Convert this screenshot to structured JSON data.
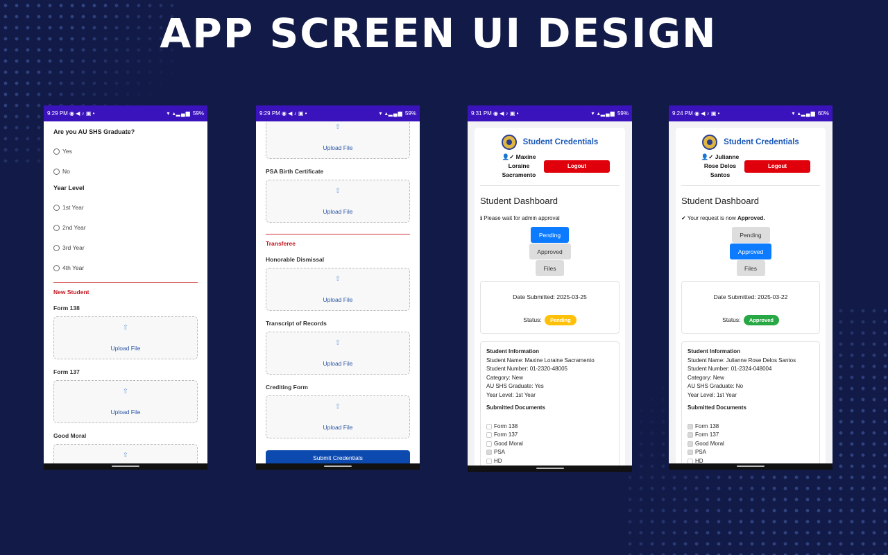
{
  "headline": "APP SCREEN UI DESIGN",
  "screen1": {
    "statusbar": {
      "time": "9:29",
      "ampm": "PM",
      "battery": "59%"
    },
    "graduate_question": "Are you AU SHS Graduate?",
    "graduate_options": [
      "Yes",
      "No"
    ],
    "year_level_label": "Year Level",
    "year_options": [
      "1st Year",
      "2nd Year",
      "3rd Year",
      "4th Year"
    ],
    "section": "New Student",
    "fields": [
      "Form 138",
      "Form 137",
      "Good Moral"
    ],
    "upload_label": "Upload File",
    "upload_icon": "upload-arrow-icon"
  },
  "screen2": {
    "statusbar": {
      "time": "9:29",
      "ampm": "PM",
      "battery": "59%"
    },
    "upload_label": "Upload File",
    "fields_top": [
      "PSA Birth Certificate"
    ],
    "section": "Transferee",
    "fields": [
      "Honorable Dismissal",
      "Transcript of Records",
      "Crediting Form"
    ],
    "submit_label": "Submit Credentials"
  },
  "screen3": {
    "statusbar": {
      "time": "9:31",
      "ampm": "PM",
      "battery": "59%"
    },
    "app_title": "Student Credentials",
    "user_name": "Maxine Loraine Sacramento",
    "logout_label": "Logout",
    "dashboard_title": "Student Dashboard",
    "notice": "Please wait for admin approval",
    "tabs": [
      "Pending",
      "Approved",
      "Files"
    ],
    "active_tab": "Pending",
    "date_submitted": "Date Submitted: 2025-03-25",
    "status_label": "Status:",
    "status_value": "Pending",
    "status_color": "#ffc107",
    "info_title": "Student Information",
    "info_lines": [
      "Student Name: Maxine Loraine Sacramento",
      "Student Number: 01-2320-48005",
      "Category: New",
      "AU SHS Graduate: Yes",
      "Year Level: 1st Year"
    ],
    "docs_title": "Submitted Documents",
    "docs": [
      {
        "name": "Form 138",
        "checked": false
      },
      {
        "name": "Form 137",
        "checked": false
      },
      {
        "name": "Good Moral",
        "checked": false
      },
      {
        "name": "PSA",
        "checked": true
      },
      {
        "name": "HD",
        "checked": false
      }
    ]
  },
  "screen4": {
    "statusbar": {
      "time": "9:24",
      "ampm": "PM",
      "battery": "60%"
    },
    "app_title": "Student Credentials",
    "user_name": "Julianne Rose Delos Santos",
    "logout_label": "Logout",
    "dashboard_title": "Student Dashboard",
    "notice_prefix": "Your request is now",
    "notice_strong": "Approved.",
    "tabs": [
      "Pending",
      "Approved",
      "Files"
    ],
    "active_tab": "Approved",
    "date_submitted": "Date Submitted: 2025-03-22",
    "status_label": "Status:",
    "status_value": "Approved",
    "status_color": "#28a745",
    "info_title": "Student Information",
    "info_lines": [
      "Student Name: Julianne Rose Delos Santos",
      "Student Number: 01-2324-048004",
      "Category: New",
      "AU SHS Graduate: No",
      "Year Level: 1st Year"
    ],
    "docs_title": "Submitted Documents",
    "docs": [
      {
        "name": "Form 138",
        "checked": true
      },
      {
        "name": "Form 137",
        "checked": true
      },
      {
        "name": "Good Moral",
        "checked": true
      },
      {
        "name": "PSA",
        "checked": true
      },
      {
        "name": "HD",
        "checked": false
      }
    ]
  }
}
